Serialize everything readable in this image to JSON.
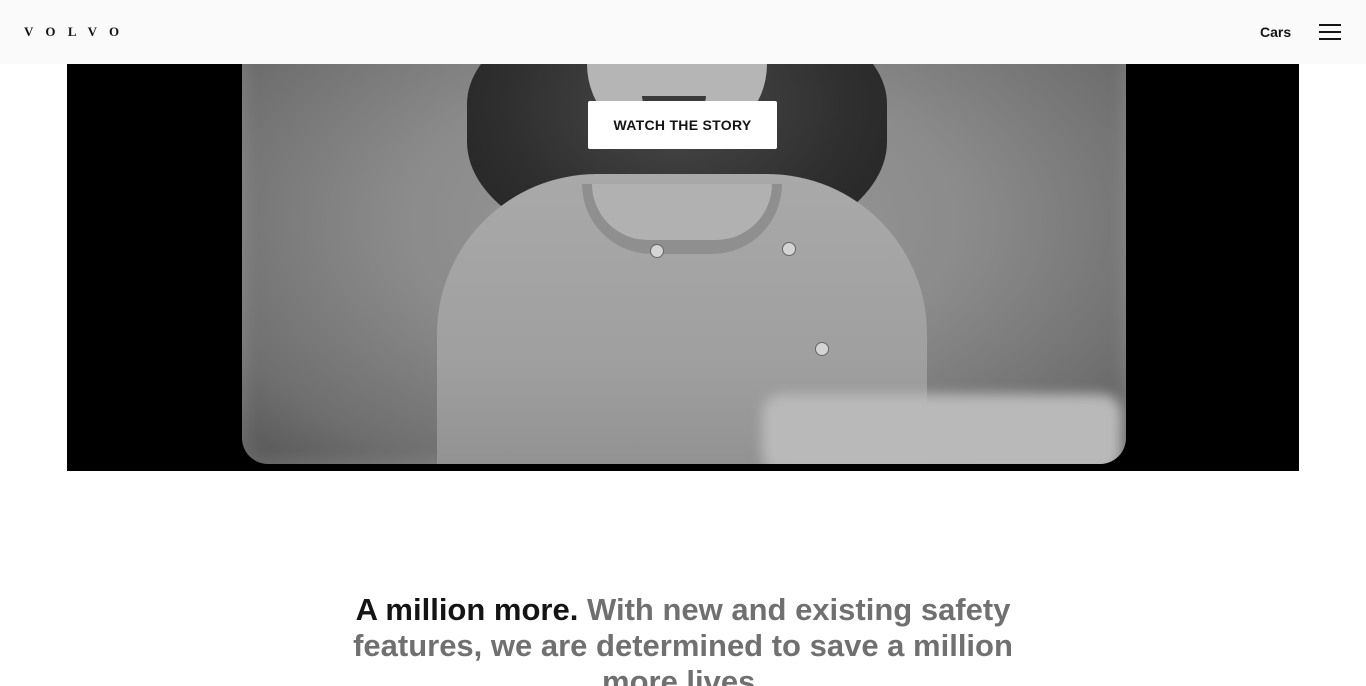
{
  "header": {
    "logo_text": "VOLVO",
    "nav_link": "Cars",
    "menu_icon": "hamburger-menu-icon"
  },
  "hero": {
    "cta_label": "WATCH THE STORY"
  },
  "statement": {
    "lead": "A million more.",
    "body": "With new and existing safety features, we are determined to save a million more lives."
  },
  "colors": {
    "header_bg": "#fafafa",
    "text_dark": "#141414",
    "text_muted": "#707070",
    "hero_bg": "#000000"
  }
}
